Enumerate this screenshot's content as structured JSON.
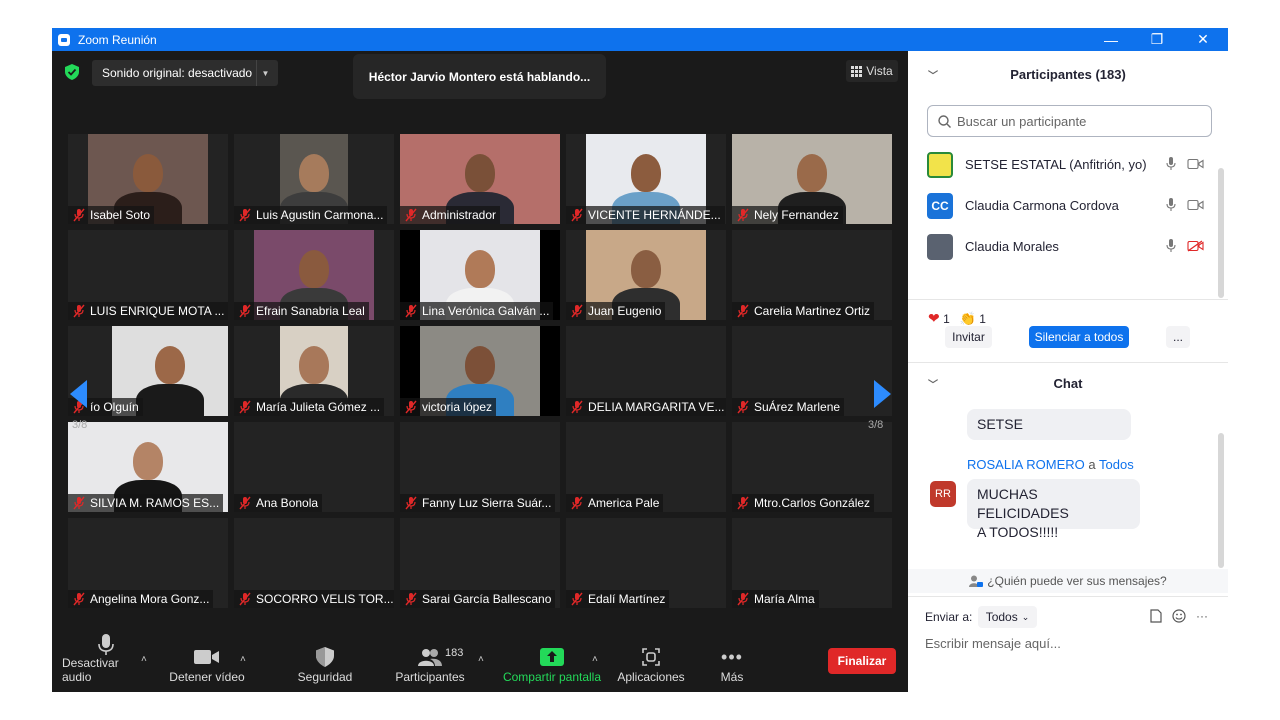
{
  "window": {
    "title": "Zoom Reunión",
    "controls": [
      "—",
      "❐",
      "✕"
    ]
  },
  "meeting": {
    "audio_label": "Sonido original: desactivado",
    "speaking": "Héctor Jarvio Montero está hablando...",
    "view_label": "Vista",
    "page_left": "3/8",
    "page_right": "3/8",
    "tiles": [
      {
        "name": "Isabel Soto",
        "video": true,
        "bg": "#6d5750",
        "vx": 20,
        "vw": 120,
        "skin": "#8a5a3c",
        "shirt": "#2b1e1a"
      },
      {
        "name": "Luis Agustin Carmona...",
        "video": true,
        "bg": "#5a5650",
        "vx": 46,
        "vw": 68,
        "skin": "#a67b5c",
        "shirt": "#3d3d3d"
      },
      {
        "name": "Administrador",
        "video": true,
        "bg": "#b56f6a",
        "vx": 0,
        "vw": 160,
        "skin": "#7a5038",
        "shirt": "#2a2a35"
      },
      {
        "name": "VICENTE HERNÁNDE...",
        "video": true,
        "bg": "#e8eaee",
        "vx": 20,
        "vw": 120,
        "skin": "#8c5c3e",
        "shirt": "#6aa0c8"
      },
      {
        "name": "Nely Fernandez",
        "video": true,
        "bg": "#b8b2a8",
        "vx": 0,
        "vw": 160,
        "skin": "#9a6a4a",
        "shirt": "#1f1f1f"
      },
      {
        "name": "LUIS ENRIQUE MOTA ...",
        "video": false
      },
      {
        "name": "Efrain Sanabria Leal",
        "video": true,
        "bg": "#7a4a6a",
        "vx": 20,
        "vw": 120,
        "skin": "#8a5a3e",
        "shirt": "#3a3a3a"
      },
      {
        "name": "Lina Verónica Galván ...",
        "video": true,
        "bg": "#e4e4e8",
        "vx": 20,
        "vw": 120,
        "skin": "#b07a58",
        "shirt": "#f2f2f2",
        "dark": true
      },
      {
        "name": "Juan Eugenio",
        "video": true,
        "bg": "#c8a888",
        "vx": 20,
        "vw": 120,
        "skin": "#8a5e42",
        "shirt": "#2e2e2e"
      },
      {
        "name": "Carelia Martinez Ortiz",
        "video": false
      },
      {
        "name": "ío Olguín",
        "video": true,
        "bg": "#dedede",
        "vx": 44,
        "vw": 116,
        "skin": "#9c6848",
        "shirt": "#1a1a1a"
      },
      {
        "name": "María Julieta Gómez ...",
        "video": true,
        "bg": "#d8d0c4",
        "vx": 46,
        "vw": 68,
        "skin": "#a8785a",
        "shirt": "#2a2a2a"
      },
      {
        "name": "victoria lópez",
        "video": true,
        "bg": "#8c8a84",
        "vx": 20,
        "vw": 120,
        "skin": "#7c5038",
        "shirt": "#2f7fc1",
        "dark": true
      },
      {
        "name": "DELIA MARGARITA VE...",
        "video": false
      },
      {
        "name": "SuÁrez Marlene",
        "video": false
      },
      {
        "name": "SILVIA M. RAMOS ES...",
        "video": true,
        "bg": "#e8e8ea",
        "vx": 0,
        "vw": 160,
        "skin": "#b48466",
        "shirt": "#151515"
      },
      {
        "name": "Ana Bonola",
        "video": false
      },
      {
        "name": "Fanny Luz Sierra Suár...",
        "video": false
      },
      {
        "name": "America Pale",
        "video": false
      },
      {
        "name": "Mtro.Carlos González",
        "video": false
      },
      {
        "name": "Angelina Mora Gonz...",
        "video": false
      },
      {
        "name": "SOCORRO VELIS TOR...",
        "video": false
      },
      {
        "name": "Sarai García Ballescano",
        "video": false
      },
      {
        "name": "Edalí Martínez",
        "video": false
      },
      {
        "name": "María Alma",
        "video": false
      }
    ]
  },
  "toolbar": {
    "mute_audio": "Desactivar audio",
    "stop_video": "Detener vídeo",
    "security": "Seguridad",
    "participants": "Participantes",
    "participants_count": "183",
    "share_screen": "Compartir pantalla",
    "apps": "Aplicaciones",
    "more": "Más",
    "end": "Finalizar"
  },
  "participants_panel": {
    "title": "Participantes (183)",
    "search_placeholder": "Buscar un participante",
    "list": [
      {
        "name": "SETSE ESTATAL (Anfitrión, yo)",
        "initials": "",
        "color": "#f2e34a",
        "video_off": false
      },
      {
        "name": "Claudia Carmona Cordova",
        "initials": "CC",
        "color": "#1a73d9",
        "video_off": false
      },
      {
        "name": "Claudia Morales",
        "initials": "",
        "color": "#5a6270",
        "video_off": true
      }
    ],
    "reaction_heart_count": "1",
    "reaction_clap_count": "1",
    "invite": "Invitar",
    "mute_all": "Silenciar a todos",
    "more": "..."
  },
  "chat": {
    "title": "Chat",
    "prev_message_tail": "SETSE",
    "sender": "ROSALIA ROMERO",
    "to_word": "a",
    "recipient": "Todos",
    "sender_initials": "RR",
    "message_line1": "MUCHAS FELICIDADES",
    "message_line2": "A TODOS!!!!!",
    "who_can_see": "¿Quién puede ver sus mensajes?",
    "send_to_label": "Enviar a:",
    "send_to_value": "Todos",
    "input_placeholder": "Escribir mensaje aquí..."
  },
  "colors": {
    "accent": "#0e72ed",
    "end_button": "#e02828",
    "share_green": "#23d959",
    "muted_red": "#e02828"
  }
}
